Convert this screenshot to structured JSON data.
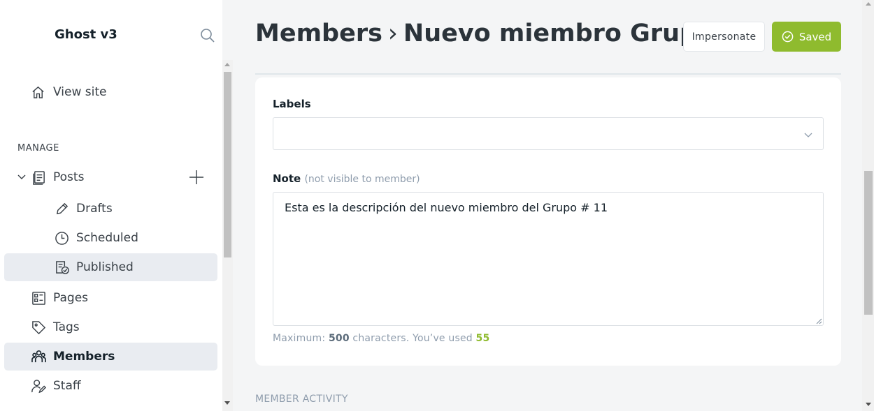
{
  "app": {
    "brand": "Ghost v3"
  },
  "sidebar": {
    "view_site": "View site",
    "section_manage": "MANAGE",
    "posts": "Posts",
    "drafts": "Drafts",
    "scheduled": "Scheduled",
    "published": "Published",
    "pages": "Pages",
    "tags": "Tags",
    "members": "Members",
    "staff": "Staff"
  },
  "header": {
    "crumb_root": "Members",
    "crumb_sep": "›",
    "crumb_current": "Nuevo miembro Grupo #",
    "impersonate_label": "Impersonate",
    "saved_label": "Saved"
  },
  "form": {
    "labels_title": "Labels",
    "labels_value": "",
    "note_title": "Note",
    "note_hint": "(not visible to member)",
    "note_value": "Esta es la descripción del nuevo miembro del Grupo # 11",
    "counter_prefix": "Maximum: ",
    "counter_max": "500",
    "counter_mid": " characters. You’ve used ",
    "counter_used": "55"
  },
  "activity_title": "MEMBER ACTIVITY",
  "colors": {
    "accent": "#8fbb2e",
    "active_bg": "#e9ecf1"
  },
  "icons": [
    "search-icon",
    "home-icon",
    "chevron-down-icon",
    "posts-icon",
    "plus-icon",
    "pencil-icon",
    "clock-icon",
    "published-icon",
    "pages-icon",
    "tag-icon",
    "members-icon",
    "staff-icon",
    "check-circle-icon"
  ]
}
